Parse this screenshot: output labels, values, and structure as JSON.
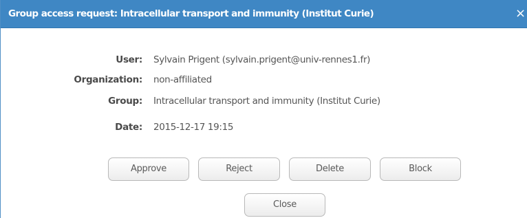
{
  "dialog": {
    "title": "Group access request: Intracellular transport and immunity (Institut Curie)",
    "close_icon": "×"
  },
  "fields": [
    {
      "label": "User:",
      "value": "Sylvain Prigent (sylvain.prigent@univ-rennes1.fr)"
    },
    {
      "label": "Organization:",
      "value": "non-affiliated"
    },
    {
      "label": "Group:",
      "value": "Intracellular transport and immunity (Institut Curie)"
    },
    {
      "label": "Date:",
      "value": "2015-12-17 19:15"
    }
  ],
  "actions": {
    "approve": "Approve",
    "reject": "Reject",
    "delete": "Delete",
    "block": "Block",
    "close": "Close"
  },
  "colors": {
    "titlebar": "#3f87c4",
    "title_text": "#ffffff",
    "label_text": "#4a4a4a",
    "value_text": "#555555"
  }
}
